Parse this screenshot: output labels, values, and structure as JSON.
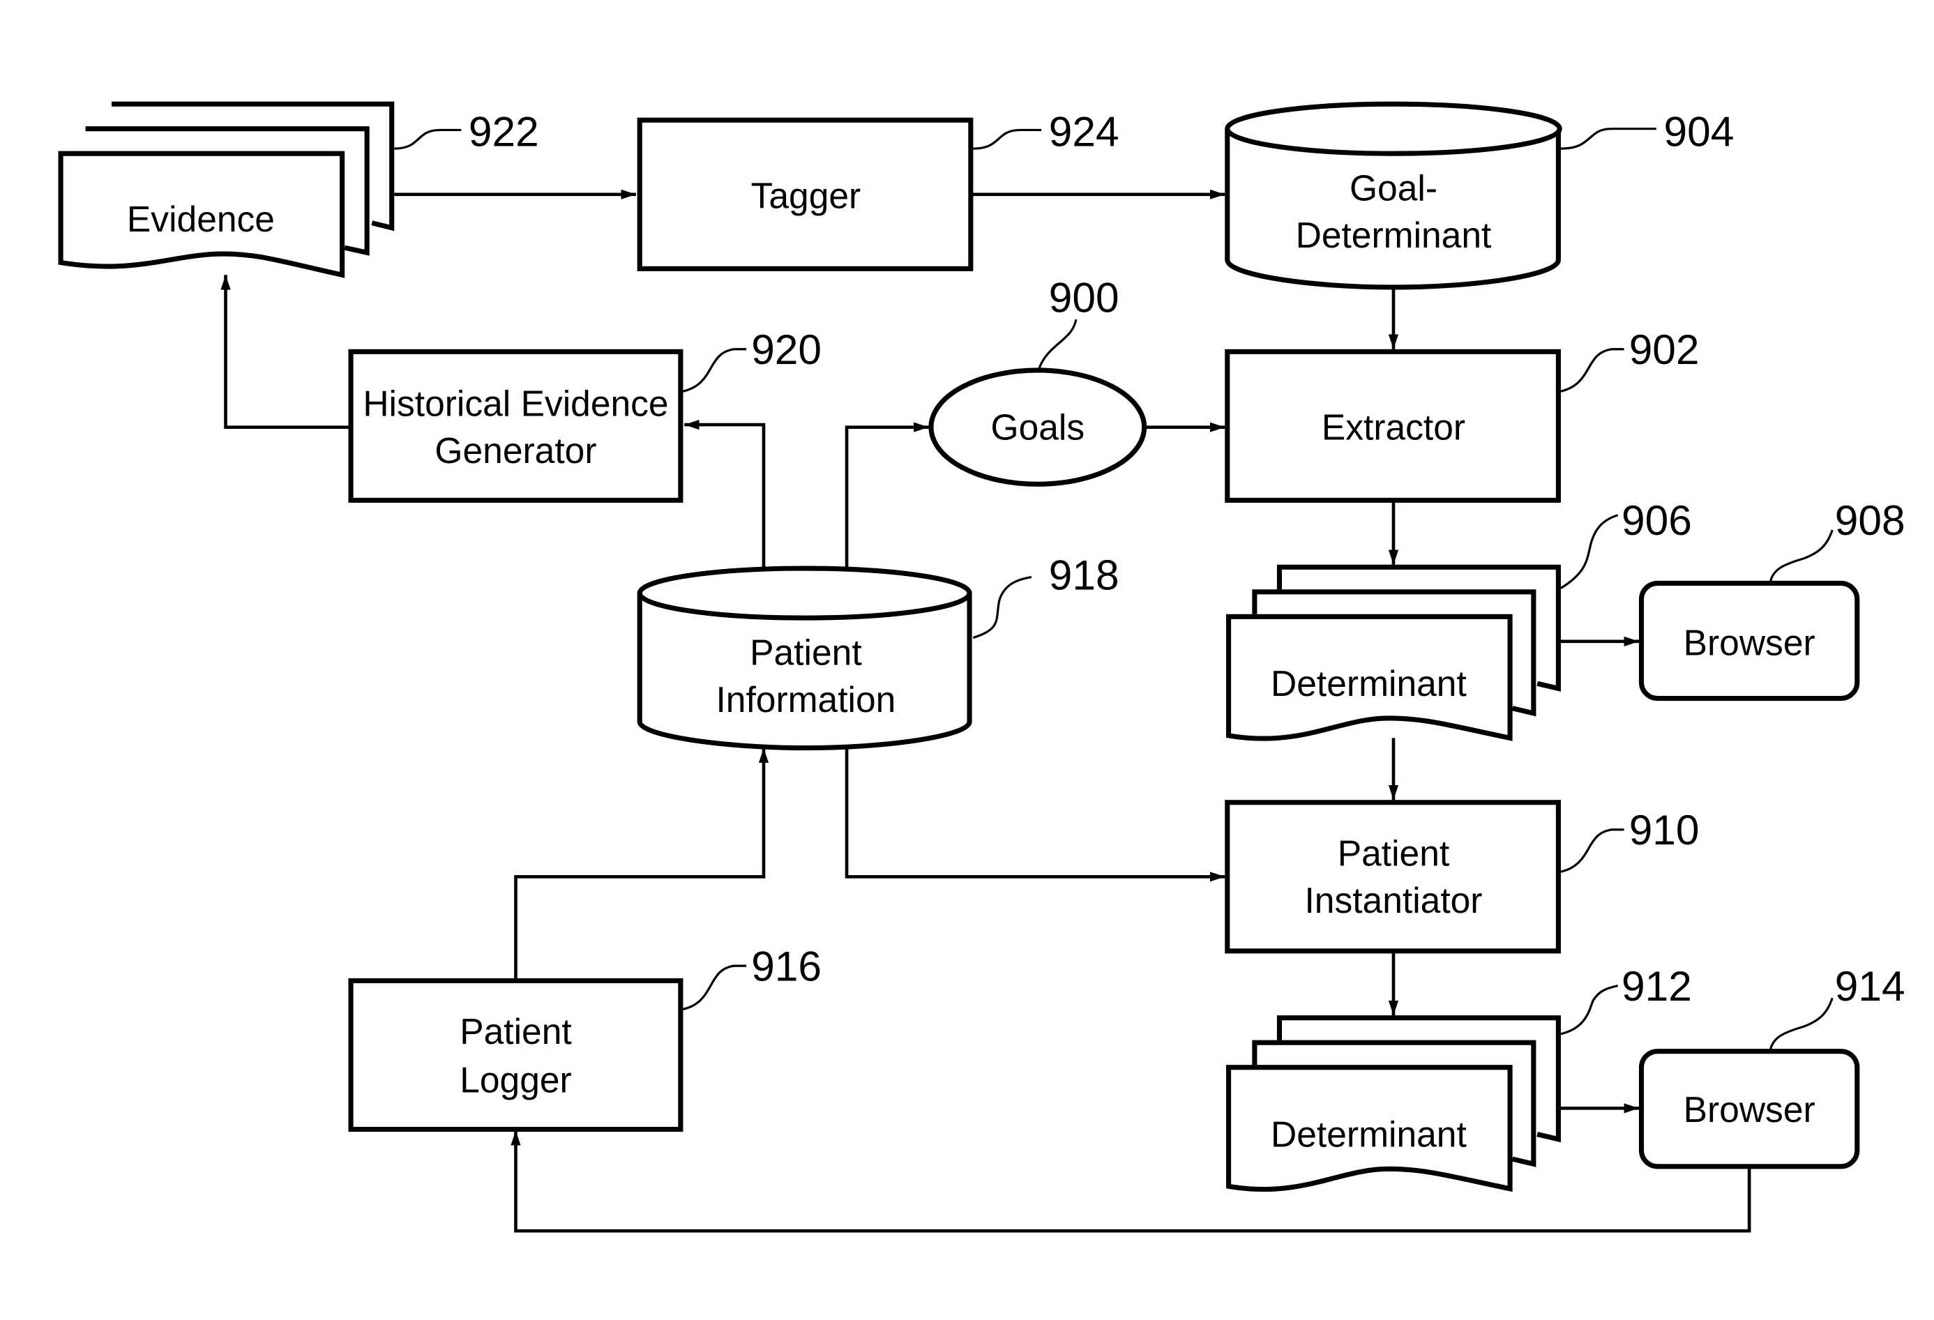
{
  "figure": {
    "nodes": {
      "evidence": {
        "label": "Evidence",
        "ref": "922",
        "shape": "document-stack"
      },
      "tagger": {
        "label": "Tagger",
        "ref": "924",
        "shape": "rectangle"
      },
      "goal_determinant": {
        "label_line1": "Goal-",
        "label_line2": "Determinant",
        "ref": "904",
        "shape": "cylinder"
      },
      "goals": {
        "label": "Goals",
        "ref": "900",
        "shape": "ellipse"
      },
      "extractor": {
        "label": "Extractor",
        "ref": "902",
        "shape": "rectangle"
      },
      "historical_evidence_generator": {
        "label_line1": "Historical Evidence",
        "label_line2": "Generator",
        "ref": "920",
        "shape": "rectangle"
      },
      "patient_information": {
        "label_line1": "Patient",
        "label_line2": "Information",
        "ref": "918",
        "shape": "cylinder"
      },
      "determinant_1": {
        "label": "Determinant",
        "ref": "906",
        "shape": "document-stack"
      },
      "browser_1": {
        "label": "Browser",
        "ref": "908",
        "shape": "rounded-rectangle"
      },
      "patient_instantiator": {
        "label_line1": "Patient",
        "label_line2": "Instantiator",
        "ref": "910",
        "shape": "rectangle"
      },
      "determinant_2": {
        "label": "Determinant",
        "ref": "912",
        "shape": "document-stack"
      },
      "browser_2": {
        "label": "Browser",
        "ref": "914",
        "shape": "rounded-rectangle"
      },
      "patient_logger": {
        "label_line1": "Patient",
        "label_line2": "Logger",
        "ref": "916",
        "shape": "rectangle"
      }
    },
    "edges": [
      {
        "from": "Evidence",
        "to": "Tagger"
      },
      {
        "from": "Tagger",
        "to": "Goal-Determinant"
      },
      {
        "from": "Goal-Determinant",
        "to": "Extractor"
      },
      {
        "from": "Goals",
        "to": "Extractor"
      },
      {
        "from": "Patient Information",
        "to": "Goals"
      },
      {
        "from": "Patient Information",
        "to": "Historical Evidence Generator"
      },
      {
        "from": "Historical Evidence Generator",
        "to": "Evidence"
      },
      {
        "from": "Extractor",
        "to": "Determinant (906)"
      },
      {
        "from": "Determinant (906)",
        "to": "Browser (908)"
      },
      {
        "from": "Determinant (906)",
        "to": "Patient Instantiator"
      },
      {
        "from": "Patient Information",
        "to": "Patient Instantiator"
      },
      {
        "from": "Patient Instantiator",
        "to": "Determinant (912)"
      },
      {
        "from": "Determinant (912)",
        "to": "Browser (914)"
      },
      {
        "from": "Browser (914)",
        "to": "Patient Logger"
      },
      {
        "from": "Patient Logger",
        "to": "Patient Information"
      }
    ]
  }
}
